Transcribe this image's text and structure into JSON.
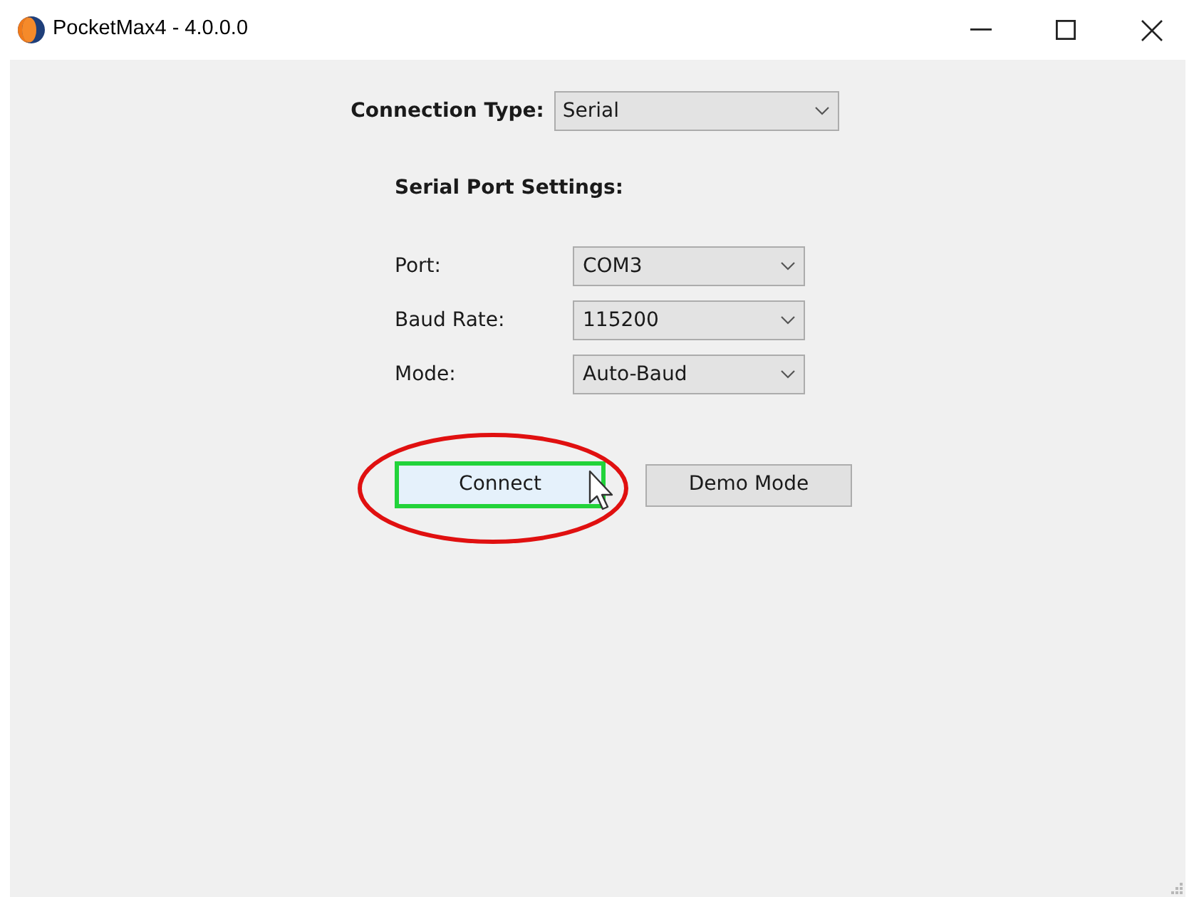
{
  "window": {
    "title": "PocketMax4 - 4.0.0.0"
  },
  "connection_type": {
    "label": "Connection Type:",
    "value": "Serial"
  },
  "serial_settings": {
    "heading": "Serial Port Settings:",
    "fields": [
      {
        "label": "Port:",
        "value": "COM3"
      },
      {
        "label": "Baud Rate:",
        "value": "115200"
      },
      {
        "label": "Mode:",
        "value": "Auto-Baud"
      }
    ]
  },
  "buttons": [
    {
      "label": "Connect",
      "hovered": true,
      "highlighted": true,
      "circled": true
    },
    {
      "label": "Demo Mode",
      "hovered": false,
      "highlighted": false,
      "circled": false
    }
  ]
}
